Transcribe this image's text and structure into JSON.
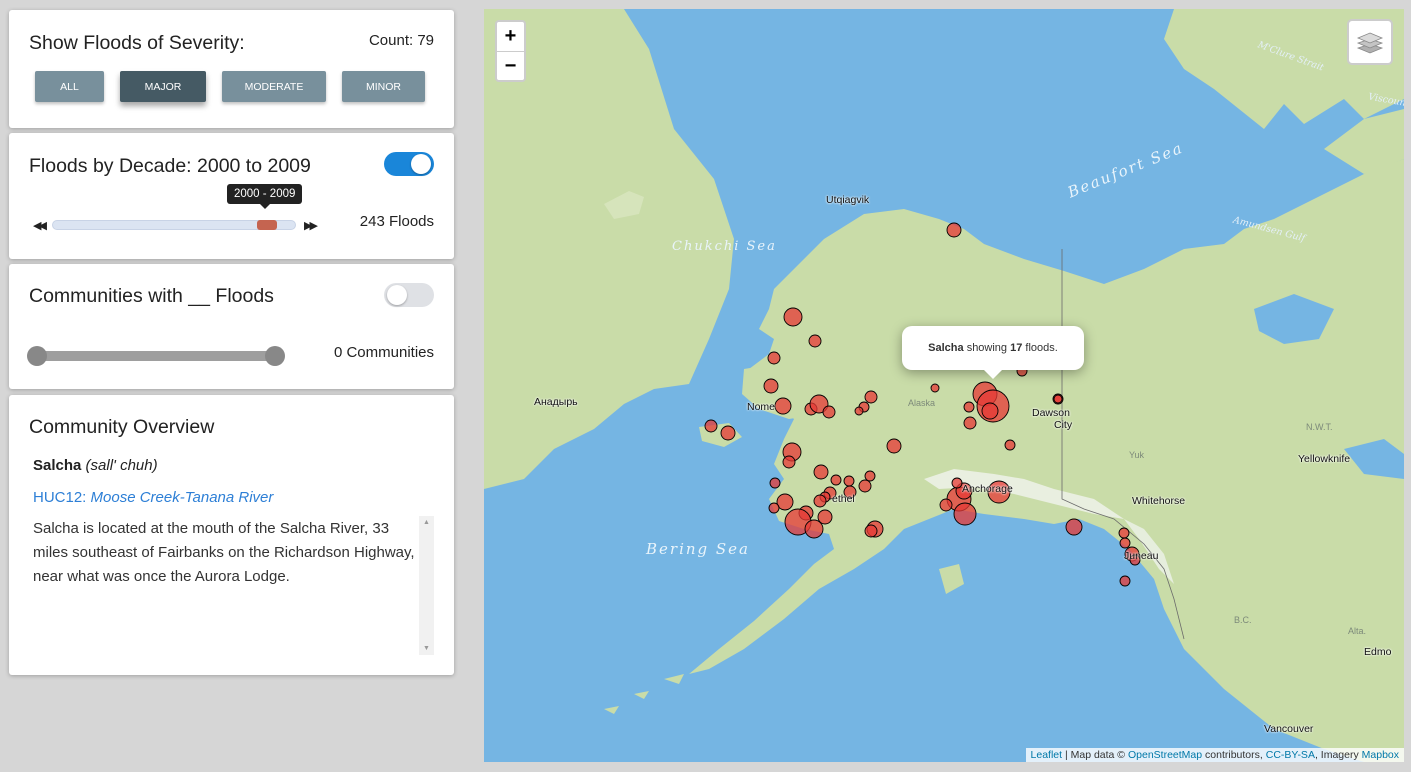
{
  "severity": {
    "title": "Show Floods of Severity:",
    "count_label": "Count: 79",
    "buttons": [
      {
        "label": "ALL",
        "active": false
      },
      {
        "label": "MAJOR",
        "active": true
      },
      {
        "label": "MODERATE",
        "active": false
      },
      {
        "label": "MINOR",
        "active": false
      }
    ]
  },
  "decade": {
    "title": "Floods by Decade: 2000 to 2009",
    "toggle_on": true,
    "tooltip": "2000 - 2009",
    "floods_label": "243 Floods",
    "range_position": 0.88
  },
  "communities": {
    "title": "Communities with __ Floods",
    "toggle_on": false,
    "count_label": "0 Communities"
  },
  "overview": {
    "title": "Community Overview",
    "name": "Salcha",
    "pronunciation": "(sall' chuh)",
    "huc_prefix": "HUC12:",
    "huc_name": "Moose Creek-Tanana River",
    "description": "Salcha is located at the mouth of the Salcha River, 33 miles southeast of Fairbanks on the Richardson Highway, near what was once the Aurora Lodge."
  },
  "map": {
    "zoom_in": "+",
    "zoom_out": "−",
    "popup": {
      "name": "Salcha",
      "middle": "showing",
      "count": "17",
      "suffix": "floods."
    },
    "attribution": {
      "leaflet": "Leaflet",
      "sep1": "| Map data ©",
      "osm": "OpenStreetMap",
      "contributors": "contributors,",
      "license": "CC-BY-SA",
      "imagery": ", Imagery",
      "mapbox": "Mapbox"
    },
    "places": {
      "utqiagvik": "Utqiagvik",
      "anadyr": "Анадырь",
      "nome": "Nome",
      "bethel": "ethel",
      "alaska": "Alaska",
      "dawson": "Dawson",
      "dawson2": "City",
      "yukon": "Yuk",
      "whitehorse": "Whitehorse",
      "juneau": "Juneau",
      "yellowknife": "Yellowknife",
      "nwt": "N.W.T.",
      "bc": "B.C.",
      "alta": "Alta.",
      "edmonton": "Edmo",
      "vancouver": "Vancouver",
      "anchorage": "Anchorage"
    },
    "waters": {
      "chukchi": "Chukchi Sea",
      "beaufort": "Beaufort Sea",
      "bering": "Bering Sea",
      "mcclure": "M'Clure Strait",
      "amundsen": "Amundsen Gulf",
      "viscount": "Viscount"
    },
    "marker_color": "#e53935",
    "land_color": "#c9dca8",
    "water_color": "#75b5e3"
  }
}
